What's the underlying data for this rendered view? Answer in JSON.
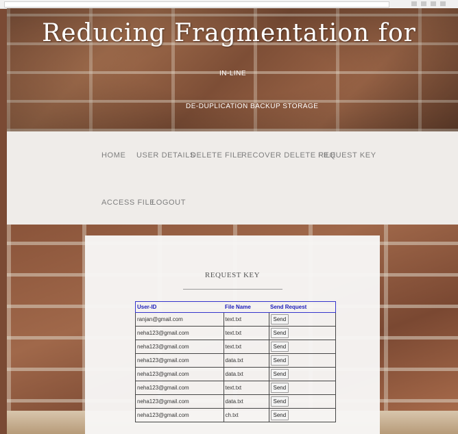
{
  "header": {
    "title": "Reducing Fragmentation for",
    "subtitle_line1": "IN-LINE",
    "subtitle_line2": "DE-DUPLICATION BACKUP STORAGE"
  },
  "nav": {
    "items": [
      {
        "label": "HOME"
      },
      {
        "label": "USER DETAILS"
      },
      {
        "label": "DELETE FILE"
      },
      {
        "label": "RECOVER DELETE FILE"
      },
      {
        "label": "REQUEST KEY"
      },
      {
        "label": "ACCESS FILE"
      },
      {
        "label": "LOGOUT"
      }
    ]
  },
  "panel": {
    "title": "REQUEST KEY"
  },
  "table": {
    "headers": [
      "User-ID",
      "File Name",
      "Send Request"
    ],
    "rows": [
      {
        "user": "ranjan@gmail.com",
        "file": "text.txt",
        "action": "Send"
      },
      {
        "user": "neha123@gmail.com",
        "file": "text.txt",
        "action": "Send"
      },
      {
        "user": "neha123@gmail.com",
        "file": "text.txt",
        "action": "Send"
      },
      {
        "user": "neha123@gmail.com",
        "file": "data.txt",
        "action": "Send"
      },
      {
        "user": "neha123@gmail.com",
        "file": "data.txt",
        "action": "Send"
      },
      {
        "user": "neha123@gmail.com",
        "file": "text.txt",
        "action": "Send"
      },
      {
        "user": "neha123@gmail.com",
        "file": "data.txt",
        "action": "Send"
      },
      {
        "user": "neha123@gmail.com",
        "file": "ch.txt",
        "action": "Send"
      }
    ]
  },
  "colors": {
    "table_header_text": "#1a1ab8",
    "nav_text": "#7d7d7d",
    "title_text": "#ffffff"
  }
}
